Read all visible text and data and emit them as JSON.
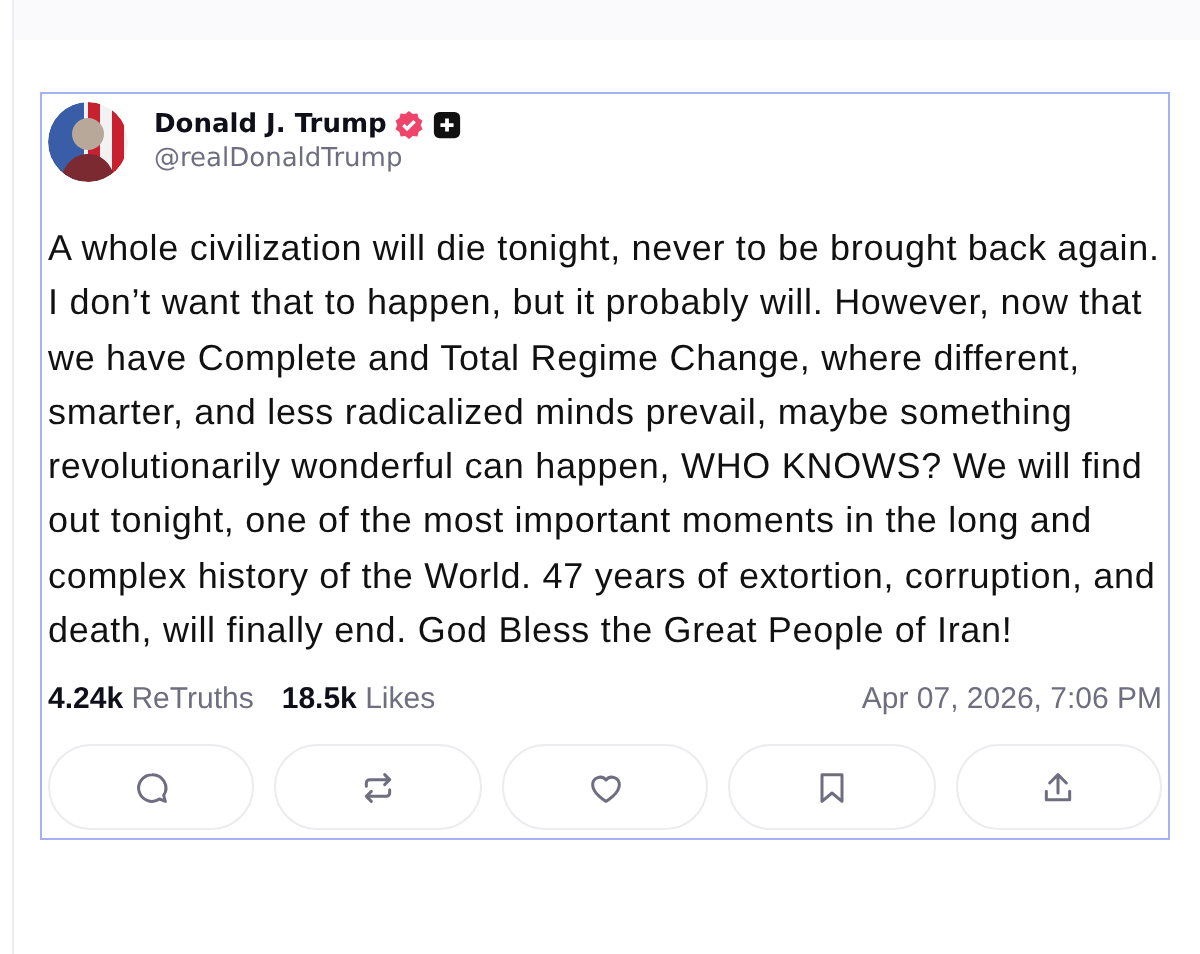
{
  "post": {
    "author": {
      "name": "Donald J. Trump",
      "handle": "@realDonaldTrump",
      "verified": true
    },
    "text": "A whole civilization will die tonight, never to be brought back again. I don’t want that to happen, but it probably will. However, now that we have Complete and Total Regime Change, where different, smarter, and less radicalized minds prevail, maybe something revolutionarily wonderful can happen, WHO KNOWS? We will find out tonight, one of the most important moments in the long and complex history of the World. 47 years of extortion, corruption, and death, will finally end. God Bless the Great People of Iran!",
    "stats": [
      {
        "count": "4.24k",
        "label": "ReTruths"
      },
      {
        "count": "18.5k",
        "label": "Likes"
      }
    ],
    "timestamp": "Apr 07, 2026, 7:06 PM",
    "actions": [
      {
        "kind": "reply"
      },
      {
        "kind": "retruth"
      },
      {
        "kind": "like"
      },
      {
        "kind": "bookmark"
      },
      {
        "kind": "share"
      }
    ]
  }
}
